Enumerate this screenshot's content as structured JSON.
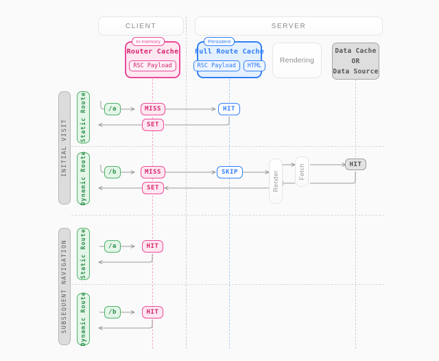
{
  "zones": {
    "client": {
      "label": "CLIENT"
    },
    "server": {
      "label": "SERVER"
    }
  },
  "caches": {
    "router_cache": {
      "tag": "In-memory",
      "title": "Router Cache",
      "chips": [
        "RSC Payload"
      ],
      "color": "#ec4899"
    },
    "full_route_cache": {
      "tag": "Persistent",
      "title": "Full Route Cache",
      "chips": [
        "RSC Payload",
        "HTML"
      ],
      "color": "#2f7df6"
    },
    "rendering": {
      "title": "Rendering",
      "color": "#e6e6e6"
    },
    "data_cache": {
      "line1": "Data Cache",
      "line2": "OR",
      "line3": "Data Source",
      "color": "#a3a3a3"
    }
  },
  "sections": [
    {
      "label": "INITIAL VISIT",
      "rows": [
        {
          "route_label": "Static Route",
          "request": "/a",
          "client_state": "MISS",
          "server_state": "HIT",
          "return_state": "SET"
        },
        {
          "route_label": "Dynamic Route",
          "request": "/b",
          "client_state": "MISS",
          "server_state": "SKIP",
          "return_state": "SET",
          "render": "Render",
          "fetch": "Fetch",
          "data_state": "HIT"
        }
      ]
    },
    {
      "label": "SUBSEQUENT NAVIGATION",
      "rows": [
        {
          "route_label": "Static Route",
          "request": "/a",
          "client_state": "HIT"
        },
        {
          "route_label": "Dynamic Route",
          "request": "/b",
          "client_state": "HIT"
        }
      ]
    }
  ],
  "colors": {
    "pink": "#ec4899",
    "blue": "#2f7df6",
    "green": "#4caf68",
    "gray": "#9e9e9e",
    "background": "#fafafa",
    "arrow": "#9a9a9a"
  }
}
